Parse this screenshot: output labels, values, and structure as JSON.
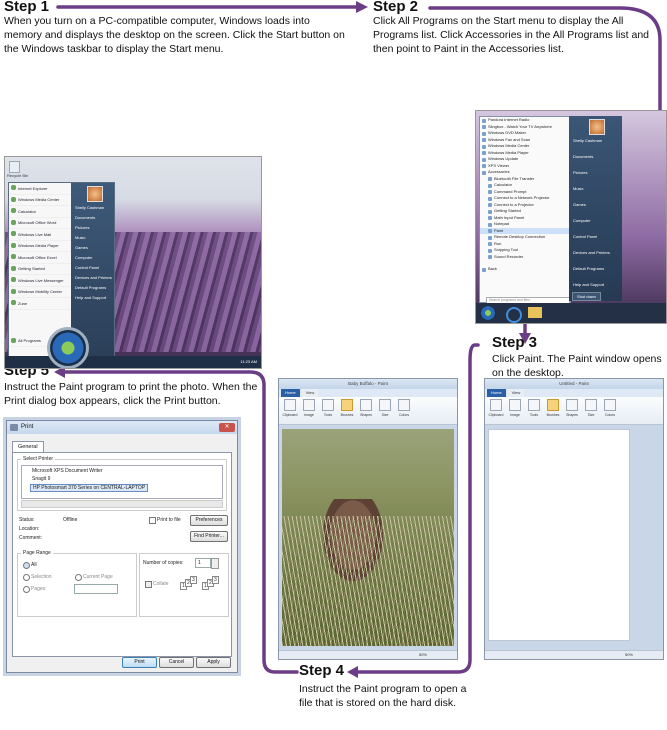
{
  "steps": {
    "s1": {
      "title": "Step 1",
      "text": "When you turn on a PC-compatible computer, Windows loads into memory and displays the desktop on the screen. Click the Start button on the Windows taskbar to display the Start menu."
    },
    "s2": {
      "title": "Step 2",
      "text": "Click All Programs on the Start menu to display the All Programs list. Click Accessories in the All Programs list and then point to Paint in the Accessories list."
    },
    "s3": {
      "title": "Step 3",
      "text": "Click Paint. The Paint window opens on the desktop."
    },
    "s4": {
      "title": "Step 4",
      "text": "Instruct the Paint program to open a file that is stored on the hard disk."
    },
    "s5": {
      "title": "Step 5",
      "text": "Instruct the Paint program to print the photo. When the Print dialog box appears, click the Print button."
    }
  },
  "desktop": {
    "recycle_bin": "Recycle Bin",
    "left_items": [
      "Internet Explorer",
      "Windows Media Center",
      "Calculator",
      "Microsoft Office Word",
      "Windows Live Mail",
      "Windows Media Player",
      "Microsoft Office Excel",
      "Getting Started",
      "Windows Live Messenger",
      "Windows Mobility Center",
      "Zune",
      "All Programs"
    ],
    "right_items": [
      "Shelly Cashman",
      "Documents",
      "Pictures",
      "Music",
      "Games",
      "Computer",
      "Control Panel",
      "Devices and Printers",
      "Default Programs",
      "Help and Support"
    ],
    "time": "11:23 AM"
  },
  "allprograms": {
    "items": [
      "Pandora Internet Radio",
      "Slingbox - Watch Your TV Anywhere",
      "Windows DVD Maker",
      "Windows Fax and Scan",
      "Windows Media Center",
      "Windows Media Player",
      "Windows Update",
      "XPS Viewer",
      "Accessories"
    ],
    "sub_items": [
      "Bluetooth File Transfer",
      "Calculator",
      "Command Prompt",
      "Connect to a Network Projector",
      "Connect to a Projector",
      "Getting Started",
      "Math Input Panel",
      "Notepad",
      "Paint",
      "Remote Desktop Connection",
      "Run",
      "Snipping Tool",
      "Sound Recorder"
    ],
    "back": "Back",
    "search": "Search programs and files",
    "right_items": [
      "Shelly Cashman",
      "Documents",
      "Pictures",
      "Music",
      "Games",
      "Computer",
      "Control Panel",
      "Devices and Printers",
      "Default Programs",
      "Help and Support"
    ],
    "shutdown": "Shut down"
  },
  "paint_photo": {
    "title": "Baby Buffalo - Paint",
    "tabs": [
      "Home",
      "View"
    ],
    "ribbon": [
      "Clipboard",
      "Image",
      "Tools",
      "Brushes",
      "Shapes",
      "Size",
      "Colors"
    ],
    "zoom": "50%"
  },
  "paint_blank": {
    "title": "Untitled - Paint",
    "tabs": [
      "Home",
      "View"
    ],
    "ribbon": [
      "Clipboard",
      "Image",
      "Tools",
      "Brushes",
      "Shapes",
      "Size",
      "Colors"
    ],
    "zoom": "50%"
  },
  "print_dialog": {
    "title": "Print",
    "tab": "General",
    "select_printer_label": "Select Printer",
    "printers": [
      "Microsoft XPS Document Writer",
      "Snagit 9",
      "HP Photosmart 370 Series on CENTRAL-LAPTOP"
    ],
    "status_label": "Status:",
    "status_value": "Offline",
    "location_label": "Location:",
    "comment_label": "Comment:",
    "print_to_file": "Print to file",
    "preferences": "Preferences",
    "find_printer": "Find Printer...",
    "page_range": "Page Range",
    "all": "All",
    "selection": "Selection",
    "current_page": "Current Page",
    "pages": "Pages:",
    "copies_label": "Number of copies:",
    "copies_value": "1",
    "collate": "Collate",
    "print_button": "Print",
    "cancel_button": "Cancel",
    "apply_button": "Apply"
  }
}
